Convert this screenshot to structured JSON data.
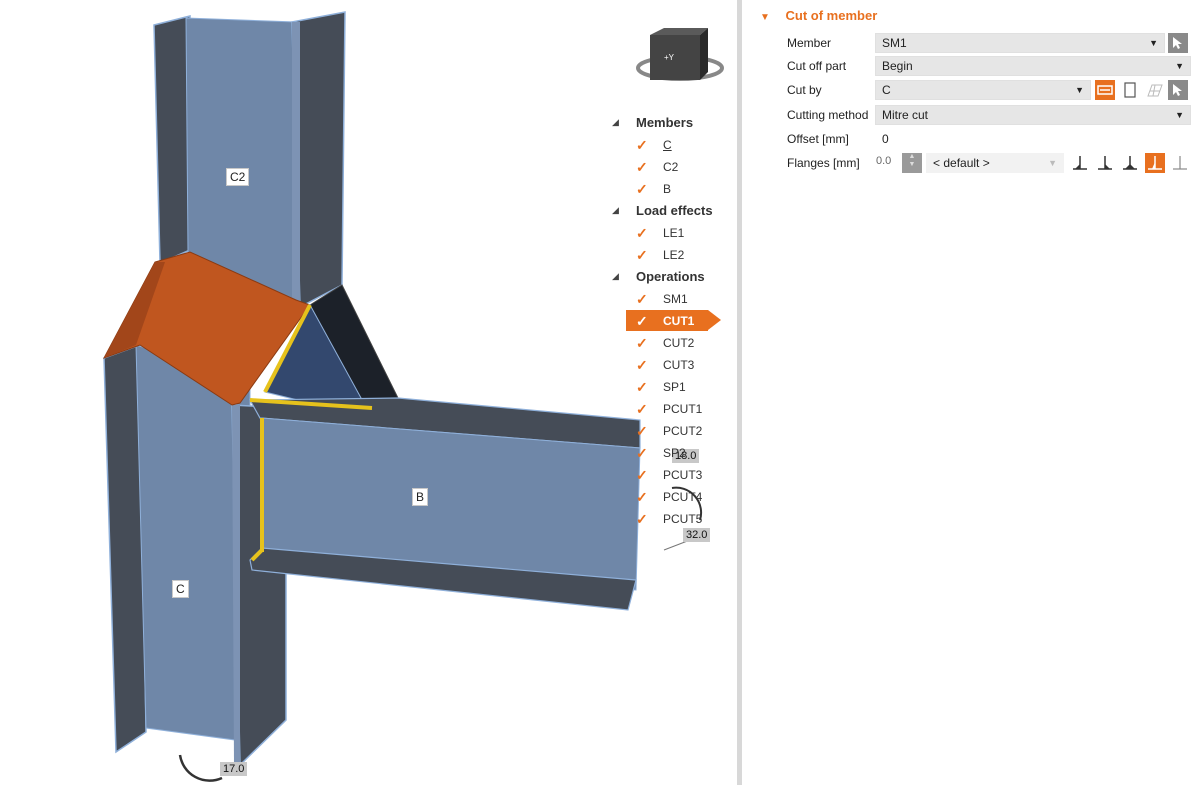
{
  "viewport": {
    "member_labels": {
      "c": "C",
      "c2": "C2",
      "b": "B"
    },
    "dimensions": {
      "dim1": "18.0",
      "dim2": "32.0",
      "dim3": "17.0"
    },
    "cube_label": "+Y"
  },
  "tree": {
    "groups": [
      {
        "label": "Members",
        "items": [
          {
            "label": "C"
          },
          {
            "label": "C2"
          },
          {
            "label": "B"
          }
        ]
      },
      {
        "label": "Load effects",
        "items": [
          {
            "label": "LE1"
          },
          {
            "label": "LE2"
          }
        ]
      },
      {
        "label": "Operations",
        "items": [
          {
            "label": "SM1"
          },
          {
            "label": "CUT1"
          },
          {
            "label": "CUT2"
          },
          {
            "label": "CUT3"
          },
          {
            "label": "SP1"
          },
          {
            "label": "PCUT1"
          },
          {
            "label": "PCUT2"
          },
          {
            "label": "SP2"
          },
          {
            "label": "PCUT3"
          },
          {
            "label": "PCUT4"
          },
          {
            "label": "PCUT5"
          }
        ]
      }
    ],
    "selected": "CUT1"
  },
  "properties": {
    "section_title": "Cut of member",
    "member": {
      "label": "Member",
      "value": "SM1"
    },
    "cut_off_part": {
      "label": "Cut off part",
      "value": "Begin"
    },
    "cut_by": {
      "label": "Cut by",
      "value": "C"
    },
    "cutting_method": {
      "label": "Cutting method",
      "value": "Mitre cut"
    },
    "offset": {
      "label": "Offset [mm]",
      "value": "0"
    },
    "flanges": {
      "label": "Flanges [mm]",
      "value": "0.0",
      "weld": "< default >"
    }
  },
  "colors": {
    "accent": "#e8701f",
    "steel": "#6f87a8",
    "steel_dark": "#454c57",
    "plate": "#c0561f",
    "weld": "#e6c21c"
  }
}
